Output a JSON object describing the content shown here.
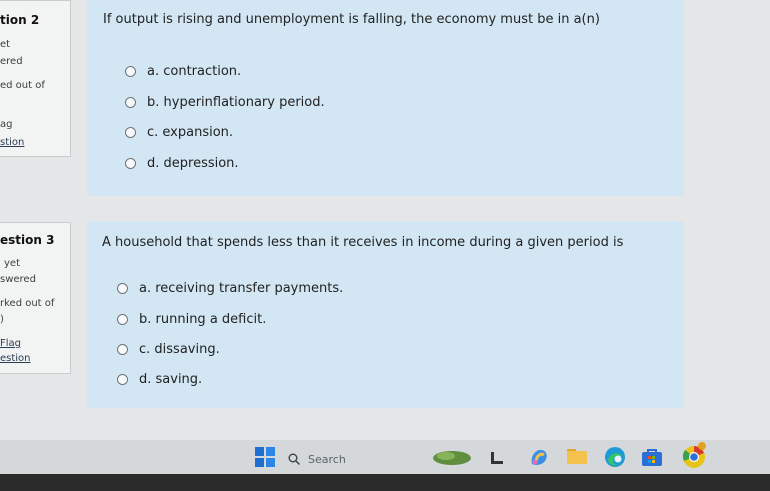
{
  "question2": {
    "number_label": "tion 2",
    "info_lines": [
      "et",
      "ered",
      "ed out of",
      "ag",
      "stion"
    ],
    "text": "If output is rising and unemployment is falling, the economy must be in a(n)",
    "options": [
      {
        "label": "a.  contraction."
      },
      {
        "label": "b.  hyperinflationary period."
      },
      {
        "label": "c.  expansion."
      },
      {
        "label": "d.  depression."
      }
    ]
  },
  "question3": {
    "number_label": "estion 3",
    "info_lines": [
      "yet",
      "swered",
      "rked out of",
      ")",
      "Flag",
      "estion"
    ],
    "text": "A household that spends less than it receives in income during a given period is",
    "options": [
      {
        "label": "a.  receiving transfer payments."
      },
      {
        "label": "b.  running a deficit."
      },
      {
        "label": "c.  dissaving."
      },
      {
        "label": "d.  saving."
      }
    ]
  },
  "taskbar": {
    "search_placeholder": "Search",
    "icons": [
      "windows-start-icon",
      "search-icon",
      "widgets-icon",
      "file-explorer-icon",
      "copilot-icon",
      "folder-icon",
      "edge-browser-icon",
      "store-icon",
      "chrome-icon"
    ]
  }
}
